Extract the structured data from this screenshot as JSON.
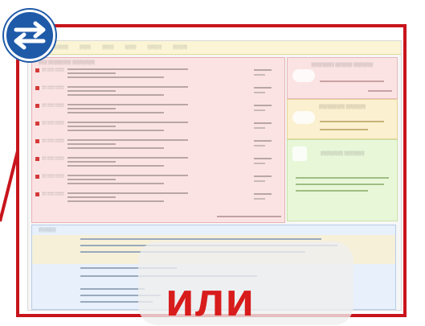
{
  "overlay": {
    "or_label": "или",
    "accent_color": "#c8141c",
    "icon_name": "swap-arrows-icon",
    "icon_color": "#1f5aa8"
  }
}
